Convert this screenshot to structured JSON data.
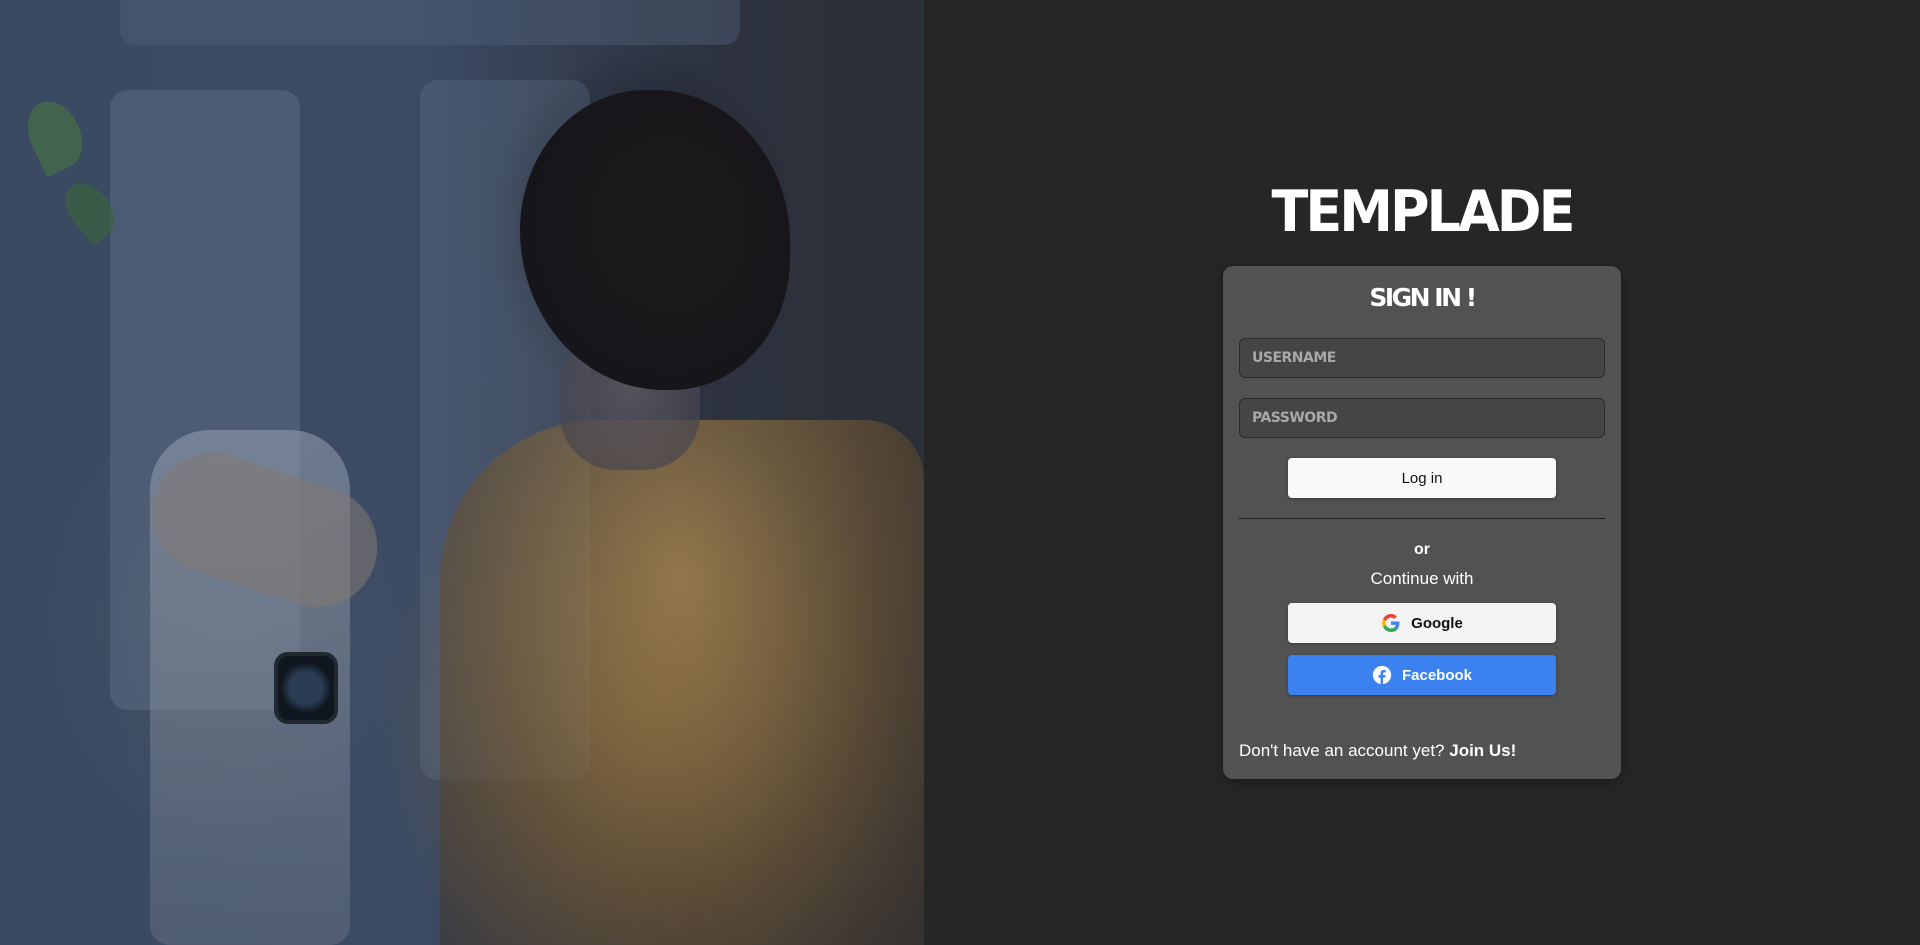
{
  "brand": {
    "name": "TEMPLADE"
  },
  "login_card": {
    "title": "SIGN IN !",
    "username_placeholder": "USERNAME",
    "password_placeholder": "PASSWORD",
    "login_label": "Log in",
    "or_label": "or",
    "continue_label": "Continue with",
    "google_label": "Google",
    "facebook_label": "Facebook",
    "signup_prompt": "Don't have an account yet?",
    "signup_link": "Join Us!"
  },
  "icons": {
    "google": "google-g-icon",
    "facebook": "facebook-f-icon"
  },
  "colors": {
    "page_background": "#262626",
    "card_background": "#525252",
    "facebook_blue": "#3b82f0",
    "button_light": "#f9f9f9"
  }
}
